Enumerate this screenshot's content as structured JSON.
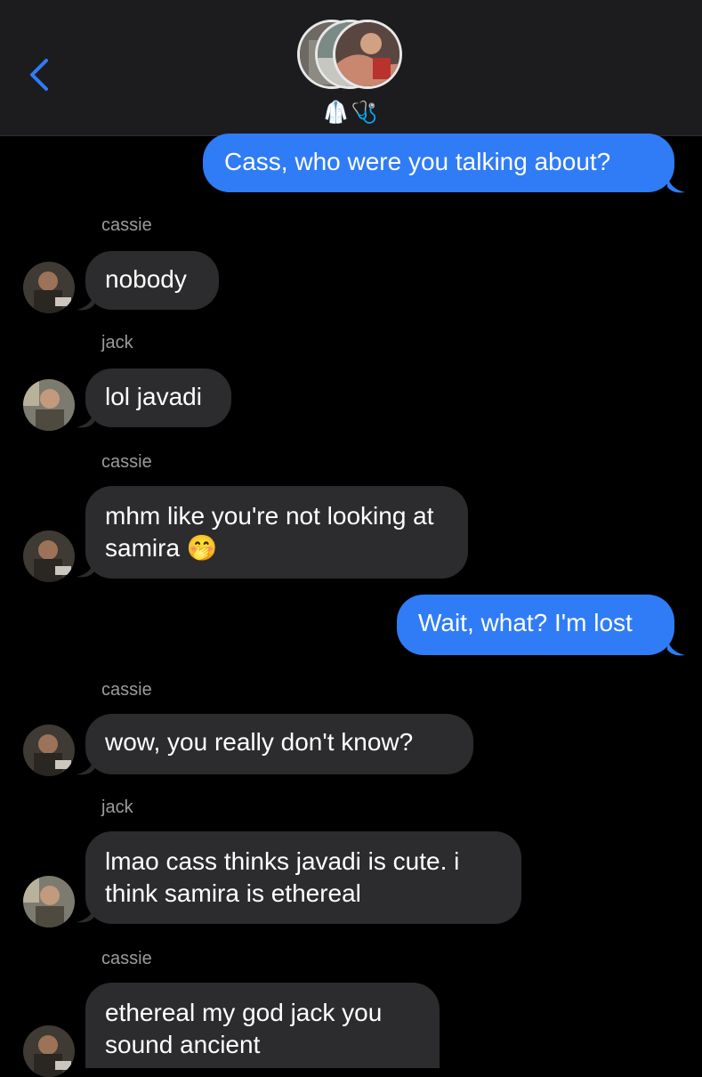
{
  "header": {
    "group_name": "🥼🩺",
    "back_label": "Back"
  },
  "colors": {
    "sent": "#2f7cf6",
    "received": "#2c2c2e",
    "background": "#000000"
  },
  "messages": [
    {
      "from": "me",
      "text": "Cass, who were you talking about?"
    },
    {
      "from": "cassie",
      "sender": "cassie",
      "text": "nobody"
    },
    {
      "from": "jack",
      "sender": "jack",
      "text": "lol javadi"
    },
    {
      "from": "cassie",
      "sender": "cassie",
      "text": "mhm like you're not looking at samira 🤭"
    },
    {
      "from": "me",
      "text": "Wait, what? I'm lost"
    },
    {
      "from": "cassie",
      "sender": "cassie",
      "text": "wow, you really don't know?"
    },
    {
      "from": "jack",
      "sender": "jack",
      "text": "lmao cass thinks javadi is cute. i think samira is ethereal"
    },
    {
      "from": "cassie",
      "sender": "cassie",
      "text": "ethereal my god jack you sound ancient"
    }
  ]
}
